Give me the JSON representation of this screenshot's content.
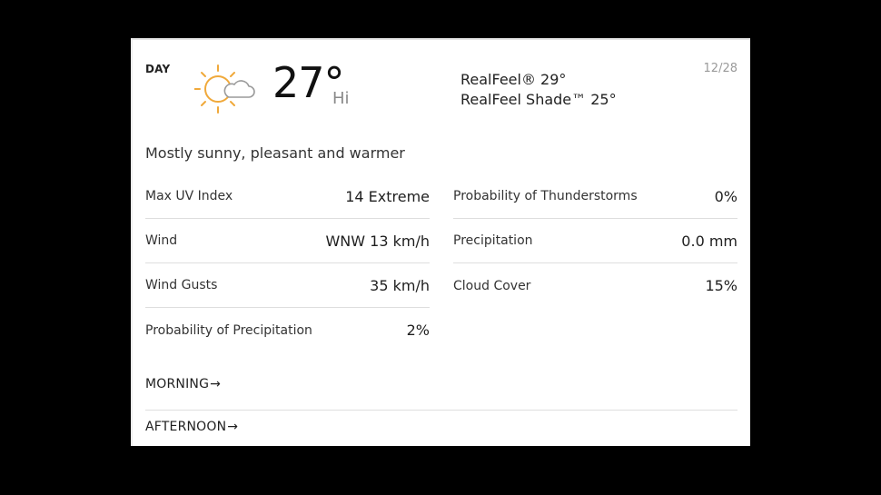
{
  "card": {
    "period_label": "DAY",
    "icon": "mostly-sunny-icon",
    "temperature": "27°",
    "temperature_suffix": "Hi",
    "realfeel": "RealFeel® 29°",
    "realfeel_shade": "RealFeel Shade™ 25°",
    "date": "12/28",
    "phrase": "Mostly sunny, pleasant and warmer",
    "colors": {
      "sun": "#f0a93b",
      "cloud": "#9a9a9a",
      "divider": "#dedede"
    }
  },
  "details": {
    "left": [
      {
        "label": "Max UV Index",
        "value": "14 Extreme"
      },
      {
        "label": "Wind",
        "value": "WNW 13 km/h"
      },
      {
        "label": "Wind Gusts",
        "value": "35 km/h"
      },
      {
        "label": "Probability of Precipitation",
        "value": "2%"
      }
    ],
    "right": [
      {
        "label": "Probability of Thunderstorms",
        "value": "0%"
      },
      {
        "label": "Precipitation",
        "value": "0.0 mm"
      },
      {
        "label": "Cloud Cover",
        "value": "15%"
      }
    ]
  },
  "links": {
    "morning": "MORNING",
    "afternoon": "AFTERNOON",
    "arrow": "→"
  }
}
